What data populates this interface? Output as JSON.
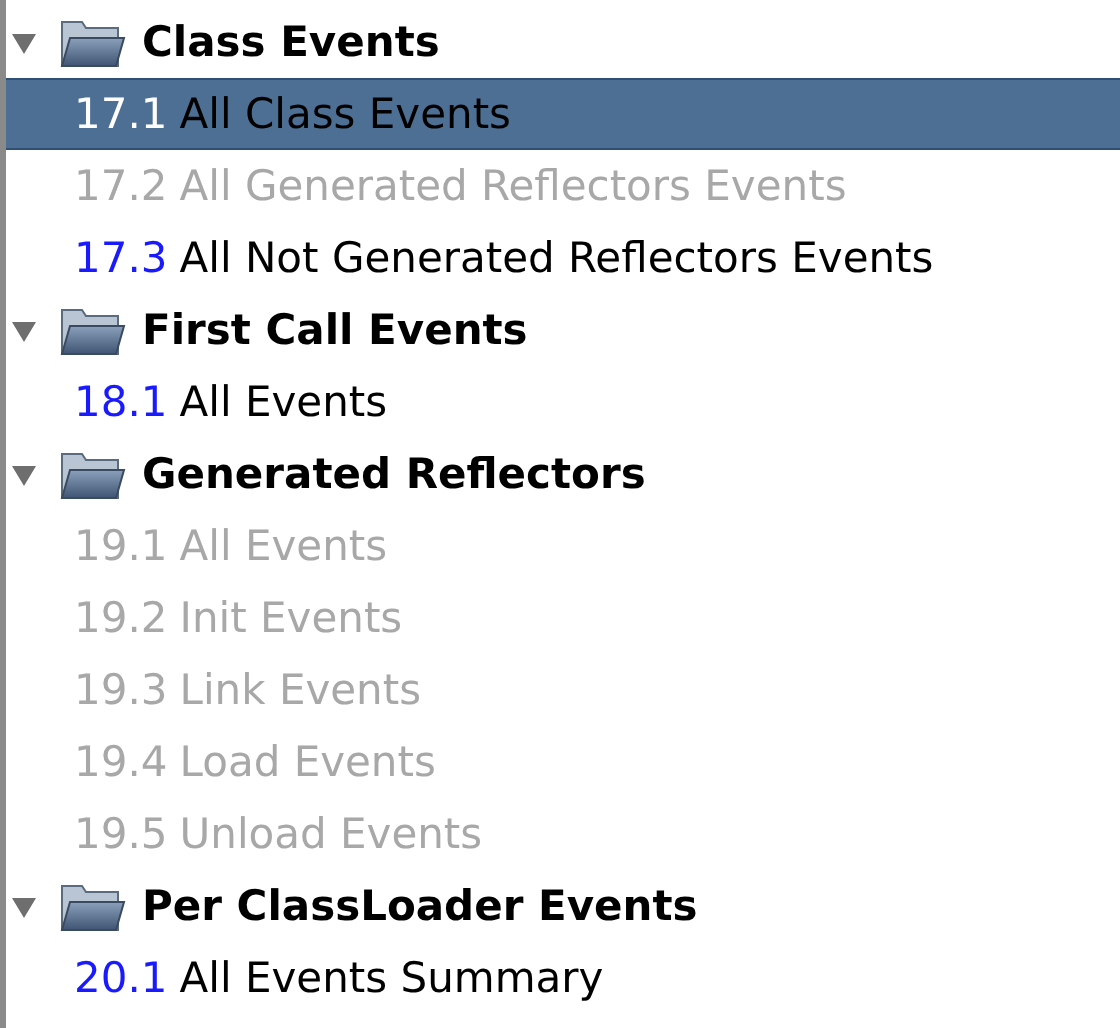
{
  "groups": [
    {
      "label": "Class Events",
      "expanded": true,
      "children": [
        {
          "number": "17.1",
          "label": "All Class Events",
          "selected": true,
          "disabled": false
        },
        {
          "number": "17.2",
          "label": "All Generated Reflectors Events",
          "selected": false,
          "disabled": true
        },
        {
          "number": "17.3",
          "label": "All Not Generated Reflectors Events",
          "selected": false,
          "disabled": false
        }
      ]
    },
    {
      "label": "First Call Events",
      "expanded": true,
      "children": [
        {
          "number": "18.1",
          "label": "All Events",
          "selected": false,
          "disabled": false
        }
      ]
    },
    {
      "label": "Generated Reflectors",
      "expanded": true,
      "children": [
        {
          "number": "19.1",
          "label": "All Events",
          "selected": false,
          "disabled": true
        },
        {
          "number": "19.2",
          "label": "Init Events",
          "selected": false,
          "disabled": true
        },
        {
          "number": "19.3",
          "label": "Link Events",
          "selected": false,
          "disabled": true
        },
        {
          "number": "19.4",
          "label": "Load Events",
          "selected": false,
          "disabled": true
        },
        {
          "number": "19.5",
          "label": "Unload Events",
          "selected": false,
          "disabled": true
        }
      ]
    },
    {
      "label": "Per ClassLoader Events",
      "expanded": true,
      "children": [
        {
          "number": "20.1",
          "label": "All Events Summary",
          "selected": false,
          "disabled": false
        }
      ]
    }
  ]
}
